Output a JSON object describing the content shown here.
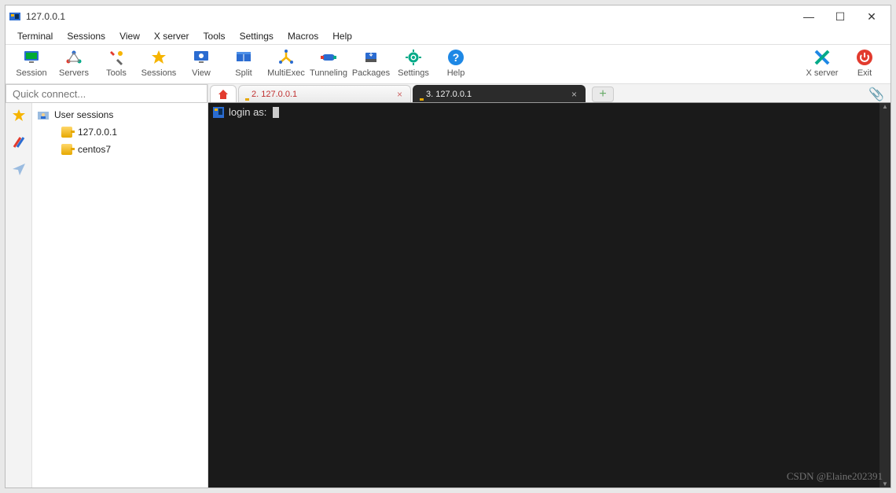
{
  "title": "127.0.0.1",
  "window_controls": {
    "min": "—",
    "max": "☐",
    "close": "✕"
  },
  "menubar": [
    "Terminal",
    "Sessions",
    "View",
    "X server",
    "Tools",
    "Settings",
    "Macros",
    "Help"
  ],
  "toolbar": [
    {
      "label": "Session",
      "icon": "session"
    },
    {
      "label": "Servers",
      "icon": "servers"
    },
    {
      "label": "Tools",
      "icon": "tools"
    },
    {
      "label": "Sessions",
      "icon": "star"
    },
    {
      "label": "View",
      "icon": "view"
    },
    {
      "label": "Split",
      "icon": "split"
    },
    {
      "label": "MultiExec",
      "icon": "multiexec"
    },
    {
      "label": "Tunneling",
      "icon": "tunnel"
    },
    {
      "label": "Packages",
      "icon": "packages"
    },
    {
      "label": "Settings",
      "icon": "settings"
    },
    {
      "label": "Help",
      "icon": "help"
    }
  ],
  "toolbar_right": [
    {
      "label": "X server",
      "icon": "xserver"
    },
    {
      "label": "Exit",
      "icon": "exit"
    }
  ],
  "quick_connect_placeholder": "Quick connect...",
  "side_tabs": [
    "star",
    "pencils",
    "paperplane"
  ],
  "tree": {
    "root_label": "User sessions",
    "items": [
      {
        "label": "127.0.0.1"
      },
      {
        "label": "centos7"
      }
    ]
  },
  "tabs": {
    "home": "home",
    "inactive": {
      "label": "2. 127.0.0.1"
    },
    "active": {
      "label": "3. 127.0.0.1"
    },
    "new": "+"
  },
  "terminal": {
    "prompt": "login as:"
  },
  "watermark": "CSDN @Elaine202391",
  "colors": {
    "accent": "#2b6cd1",
    "star": "#f6b400",
    "exit": "#e23b2e",
    "help": "#1e88e5"
  }
}
